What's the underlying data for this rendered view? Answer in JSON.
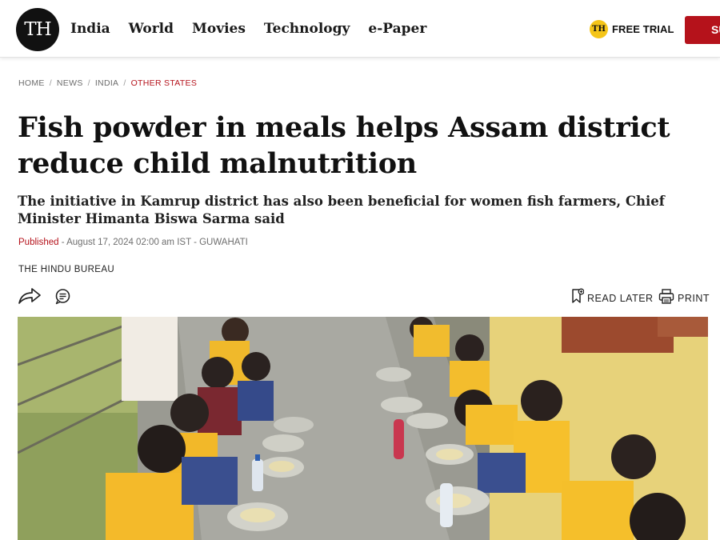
{
  "header": {
    "logo_text": "TH",
    "nav": [
      "India",
      "World",
      "Movies",
      "Technology",
      "e-Paper"
    ],
    "trial_badge": "TH",
    "trial_label": "FREE TRIAL",
    "subscribe_label": "SU"
  },
  "breadcrumb": [
    "HOME",
    "NEWS",
    "INDIA",
    "OTHER STATES"
  ],
  "article": {
    "headline": "Fish powder in meals helps Assam district reduce child malnutrition",
    "subheadline": "The initiative in Kamrup district has also been beneficial for women fish farmers, Chief Minister Himanta Biswa Sarma said",
    "published_label": "Published",
    "published_rest": " - August 17, 2024 02:00 am IST - GUWAHATI",
    "author": "THE HINDU BUREAU"
  },
  "actions": {
    "read_later": "READ LATER",
    "print": "PRINT"
  },
  "icons": {
    "share": "share-icon",
    "comment": "comment-icon",
    "bookmark": "bookmark-icon",
    "print": "printer-icon"
  },
  "colors": {
    "brand_red": "#b5121b",
    "trial_yellow": "#f5c518",
    "logo_black": "#111111"
  }
}
